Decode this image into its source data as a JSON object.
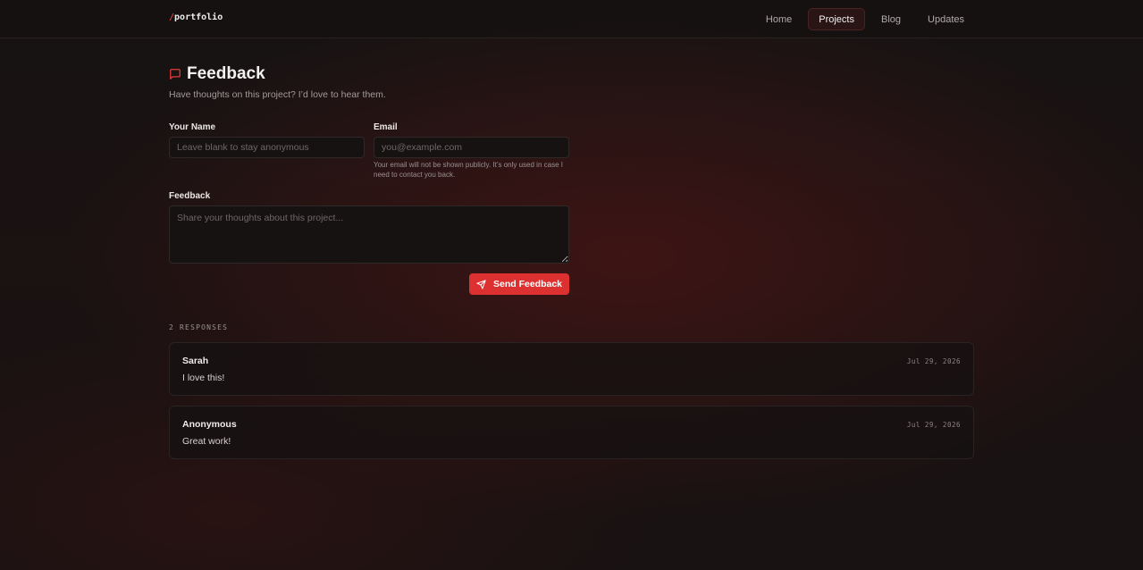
{
  "header": {
    "logo_slash": "/",
    "logo_text": "portfolio",
    "nav": [
      {
        "label": "Home",
        "active": false
      },
      {
        "label": "Projects",
        "active": true
      },
      {
        "label": "Blog",
        "active": false
      },
      {
        "label": "Updates",
        "active": false
      }
    ]
  },
  "page": {
    "title": "Feedback",
    "subtitle": "Have thoughts on this project? I’d love to hear them."
  },
  "form": {
    "name_label": "Your Name",
    "name_placeholder": "Leave blank to stay anonymous",
    "name_value": "",
    "email_label": "Email",
    "email_placeholder": "you@example.com",
    "email_value": "",
    "email_help": "Your email will not be shown publicly. It’s only used in case I need to contact you back.",
    "feedback_label": "Feedback",
    "feedback_placeholder": "Share your thoughts about this project...",
    "feedback_value": "",
    "submit_label": "Send Feedback"
  },
  "responses": {
    "count_label": "2 RESPONSES",
    "items": [
      {
        "author": "Sarah",
        "date": "Jul 29, 2026",
        "message": "I love this!"
      },
      {
        "author": "Anonymous",
        "date": "Jul 29, 2026",
        "message": "Great work!"
      }
    ]
  },
  "colors": {
    "accent": "#dd3131",
    "background": "#161313",
    "nav_active_bg": "#2a1515"
  },
  "icons": {
    "title_icon": "message-square-icon",
    "submit_icon": "send-icon"
  }
}
